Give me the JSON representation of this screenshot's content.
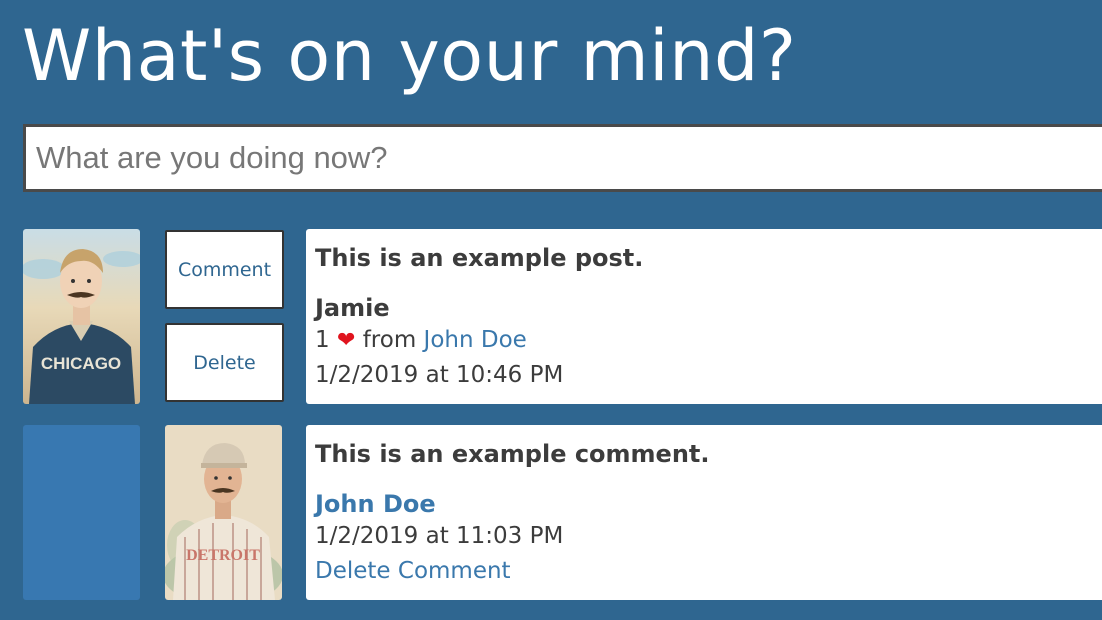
{
  "page": {
    "title": "What's on your mind?"
  },
  "composer": {
    "placeholder": "What are you doing now?"
  },
  "posts": [
    {
      "text": "This is an example post.",
      "author": "Jamie",
      "likes_count": "1",
      "likes_from_label": "from",
      "liked_by": "John Doe",
      "timestamp": "1/2/2019 at 10:46 PM",
      "actions": {
        "comment": "Comment",
        "delete": "Delete"
      },
      "avatar": {
        "icon": "chicago-player-card",
        "jersey": "CHICAGO"
      }
    }
  ],
  "comments": [
    {
      "text": "This is an example comment.",
      "author": "John Doe",
      "timestamp": "1/2/2019 at 11:03 PM",
      "delete_label": "Delete Comment",
      "avatar": {
        "icon": "detroit-player-card",
        "jersey": "DETROIT"
      }
    }
  ],
  "colors": {
    "background": "#2f6690",
    "link": "#3a78ac",
    "heart": "#e0141e",
    "comment-indent-box": "#3878b1"
  }
}
